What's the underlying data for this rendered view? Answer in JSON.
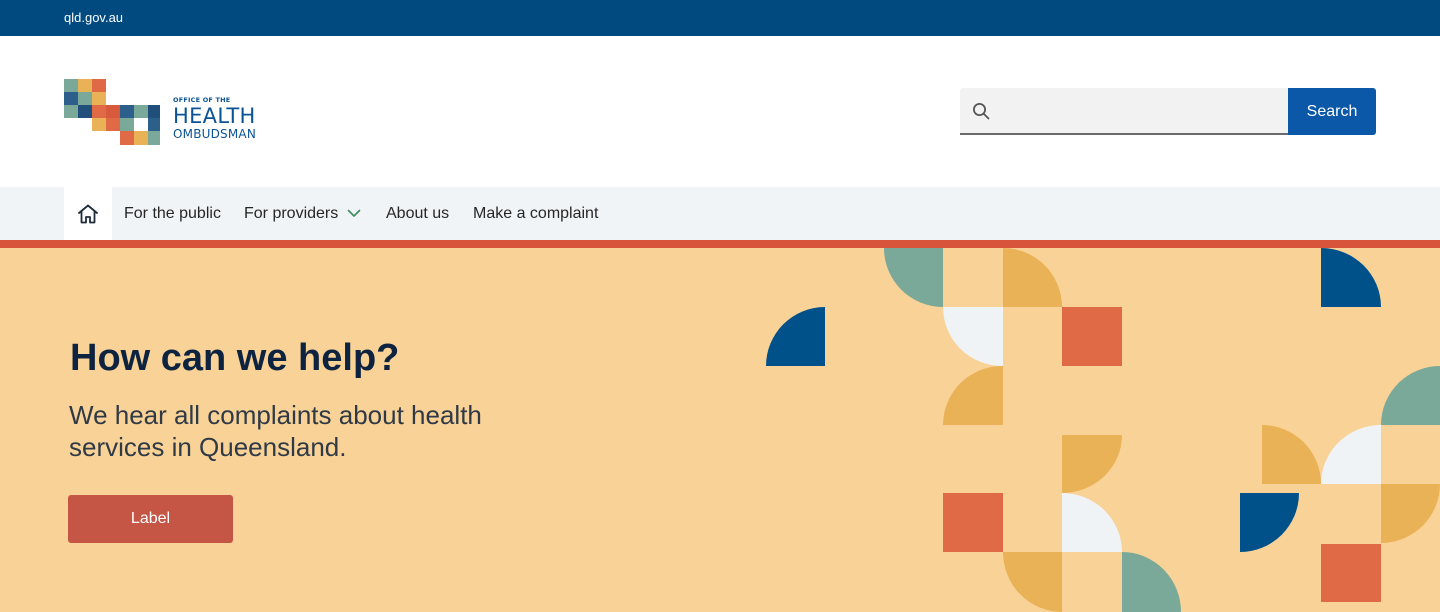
{
  "topbar": {
    "link_text": "qld.gov.au"
  },
  "logo": {
    "line1": "OFFICE OF THE",
    "line2": "HEALTH",
    "line3": "OMBUDSMAN"
  },
  "search": {
    "placeholder": "",
    "value": "",
    "button_label": "Search",
    "icon": "search-icon"
  },
  "nav": {
    "home_icon": "home-icon",
    "items": [
      {
        "label": "For the public"
      },
      {
        "label": "For providers",
        "has_dropdown": true
      },
      {
        "label": "About us"
      },
      {
        "label": "Make a complaint"
      }
    ]
  },
  "hero": {
    "title": "How can we help?",
    "subtitle": "We hear all complaints about health services in Queensland.",
    "button_label": "Label"
  },
  "colors": {
    "topbar": "#004a80",
    "search_button": "#0b58a8",
    "nav_bg": "#f1f4f7",
    "accent_rule": "#d8553c",
    "hero_bg": "#f8d296",
    "hero_button": "#c55646",
    "pattern_teal": "#7aa899",
    "pattern_mustard": "#eab257",
    "pattern_light": "#f0f3f6",
    "pattern_orange": "#e06a45",
    "pattern_navy": "#00508a"
  }
}
